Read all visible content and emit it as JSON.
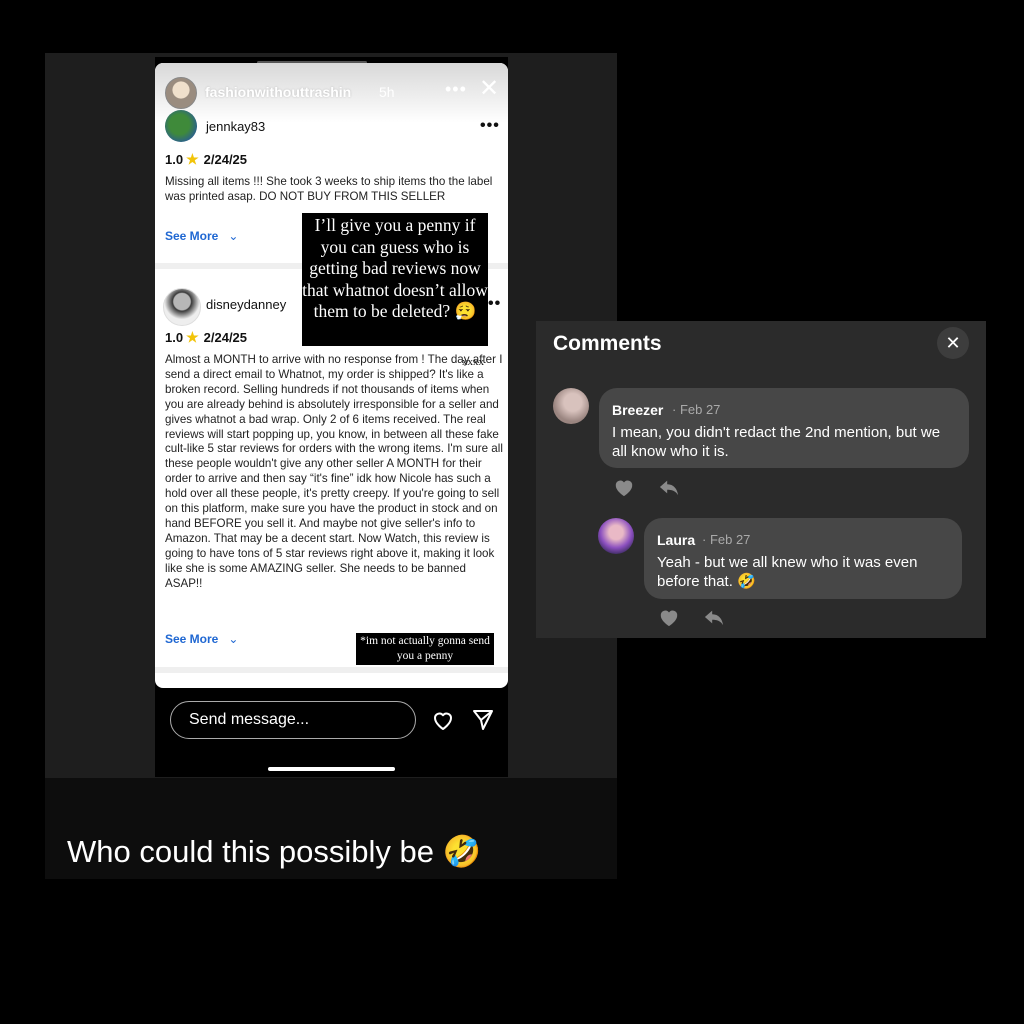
{
  "story": {
    "username": "fashionwithouttrashin",
    "time": "5h",
    "more_label": "•••",
    "close_label": "✕"
  },
  "reviews": [
    {
      "username": "jennkay83",
      "more_label": "•••",
      "rating": "1.0",
      "date": "2/24/25",
      "text": "Missing all items !!! She took 3 weeks to ship items tho the label was printed asap. DO NOT BUY FROM THIS SELLER",
      "see_more": "See More"
    },
    {
      "username": "disneydanney",
      "more_label": "••",
      "rating": "1.0",
      "date": "2/24/25",
      "text": "Almost a MONTH to arrive with no response from          ! The day after I send a direct email to Whatnot, my order is shipped? It's like a broken record. Selling hundreds if not thousands of items when you are already behind is absolutely irresponsible for a seller and gives whatnot a bad wrap. Only 2 of 6 items received. The real reviews will start popping up, you know, in between all these fake cult-like 5 star reviews for orders with the wrong items. I'm sure all these people wouldn't give any other seller A MONTH for their order to arrive and then say “it's fine” idk how Nicole has such a hold over all these people, it's pretty creepy. If you're going to sell on this platform, make sure you have the product in stock and on hand BEFORE you sell it. And maybe not give seller's info to Amazon. That may be a decent start. Now Watch, this review is going to have tons of 5 star reviews right above it, making it look like she is some AMAZING seller. She needs to be banned ASAP!!",
      "see_more": "See More"
    }
  ],
  "redaction": "xxxx",
  "overlay_text": "I’ll give you a penny if you can guess who is getting bad reviews now that whatnot doesn’t allow them to be deleted? 😮‍💨",
  "overlay_small": "*im not actually gonna send you a penny",
  "message_placeholder": "Send message...",
  "caption": "Who could this possibly be 🤣",
  "comments": {
    "title": "Comments",
    "close_label": "✕",
    "items": [
      {
        "name": "Breezer",
        "date": "· Feb 27",
        "text": "I mean, you didn't redact the 2nd mention, but we all know who it is."
      },
      {
        "name": "Laura",
        "date": "· Feb 27",
        "text": "Yeah - but we all knew who it was even before that. 🤣"
      }
    ]
  }
}
